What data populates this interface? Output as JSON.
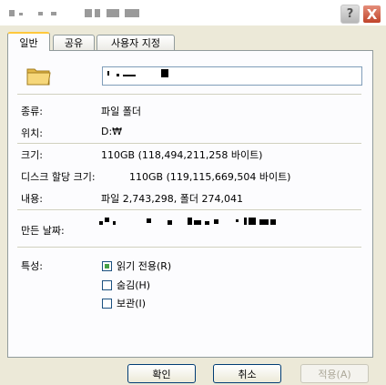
{
  "window": {
    "help_label": "?",
    "close_label": "X"
  },
  "tabs": [
    {
      "label": "일반"
    },
    {
      "label": "공유"
    },
    {
      "label": "사용자 지정"
    }
  ],
  "properties": {
    "type_label": "종류:",
    "type_value": "파일 폴더",
    "location_label": "위치:",
    "location_value": "D:₩",
    "size_label": "크기:",
    "size_value": "110GB (118,494,211,258 바이트)",
    "disk_size_label": "디스크 할당 크기:",
    "disk_size_value": "110GB (119,115,669,504 바이트)",
    "contents_label": "내용:",
    "contents_value": "파일 2,743,298, 폴더 274,041",
    "created_label": "만든 날짜:"
  },
  "attributes": {
    "label": "특성:",
    "readonly_label": "읽기 전용(R)",
    "hidden_label": "숨김(H)",
    "archive_label": "보관(I)",
    "readonly_checked": true,
    "hidden_checked": false,
    "archive_checked": false
  },
  "buttons": {
    "ok": "확인",
    "cancel": "취소",
    "apply": "적용(A)"
  },
  "icons": {
    "folder": "folder-icon",
    "help": "help-icon",
    "close": "close-icon"
  },
  "colors": {
    "dialog_bg": "#ece9d8",
    "panel_bg": "#fcfcfe",
    "tab_highlight": "#ffc83c",
    "close_button": "#c0442a",
    "checkbox_fill": "#46a046"
  }
}
